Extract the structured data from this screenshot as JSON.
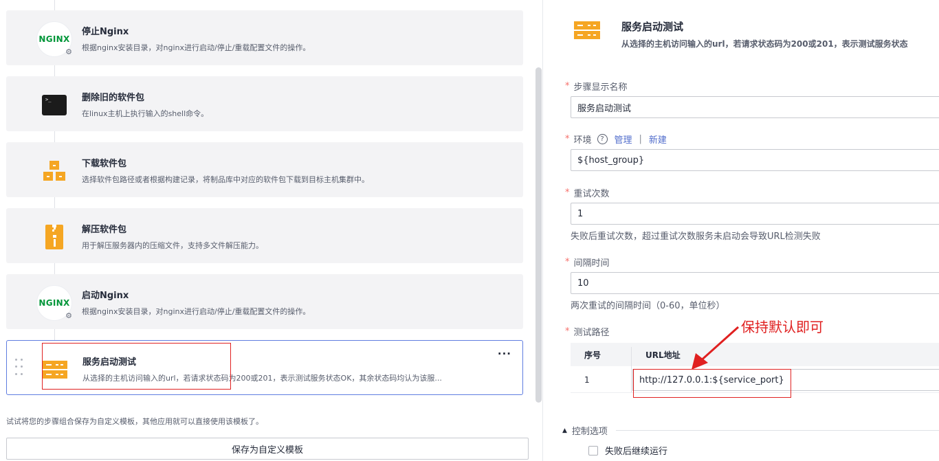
{
  "steps": [
    {
      "title": "停止Nginx",
      "desc": "根据nginx安装目录，对nginx进行启动/停止/重载配置文件的操作。",
      "icon": "nginx-icon",
      "logo_text": "NGINX"
    },
    {
      "title": "删除旧的软件包",
      "desc": "在linux主机上执行输入的shell命令。",
      "icon": "terminal-icon",
      "logo_text": ">_"
    },
    {
      "title": "下载软件包",
      "desc": "选择软件包路径或者根据构建记录，将制品库中对应的软件包下载到目标主机集群中。",
      "icon": "download-package-icon"
    },
    {
      "title": "解压软件包",
      "desc": "用于解压服务器内的压缩文件，支持多文件解压能力。",
      "icon": "zip-icon"
    },
    {
      "title": "启动Nginx",
      "desc": "根据nginx安装目录，对nginx进行启动/停止/重载配置文件的操作。",
      "icon": "nginx-icon",
      "logo_text": "NGINX"
    },
    {
      "title": "服务启动测试",
      "desc": "从选择的主机访问输入的url，若请求状态码为200或201，表示测试服务状态OK，其余状态码均认为该服...",
      "icon": "server-icon",
      "more": "···"
    }
  ],
  "hint": "试试将您的步骤组合保存为自定义模板，其他应用就可以直接使用该模板了。",
  "save_template_button": "保存为自定义模板",
  "detail": {
    "title": "服务启动测试",
    "desc": "从选择的主机访问输入的url，若请求状态码为200或201，表示测试服务状态",
    "display_name_label": "步骤显示名称",
    "display_name_value": "服务启动测试",
    "env_label": "环境",
    "env_help_icon": "?",
    "env_manage": "管理",
    "env_sep": "|",
    "env_new": "新建",
    "env_value": "${host_group}",
    "retry_label": "重试次数",
    "retry_value": "1",
    "retry_help": "失败后重试次数，超过重试次数服务未启动会导致URL检测失败",
    "interval_label": "间隔时间",
    "interval_value": "10",
    "interval_help": "两次重试的间隔时间（0-60，单位秒）",
    "test_path_label": "测试路径",
    "table_col_index": "序号",
    "table_col_url": "URL地址",
    "row_index": "1",
    "row_url": "http://127.0.0.1:${service_port}",
    "annotation": "保持默认即可",
    "control_options": "控制选项",
    "continue_on_fail": "失败后继续运行"
  },
  "colors": {
    "accent": "#5e7ce0",
    "annotation_red": "#e02020",
    "server_orange": "#f5a623",
    "nginx_green": "#009639"
  }
}
